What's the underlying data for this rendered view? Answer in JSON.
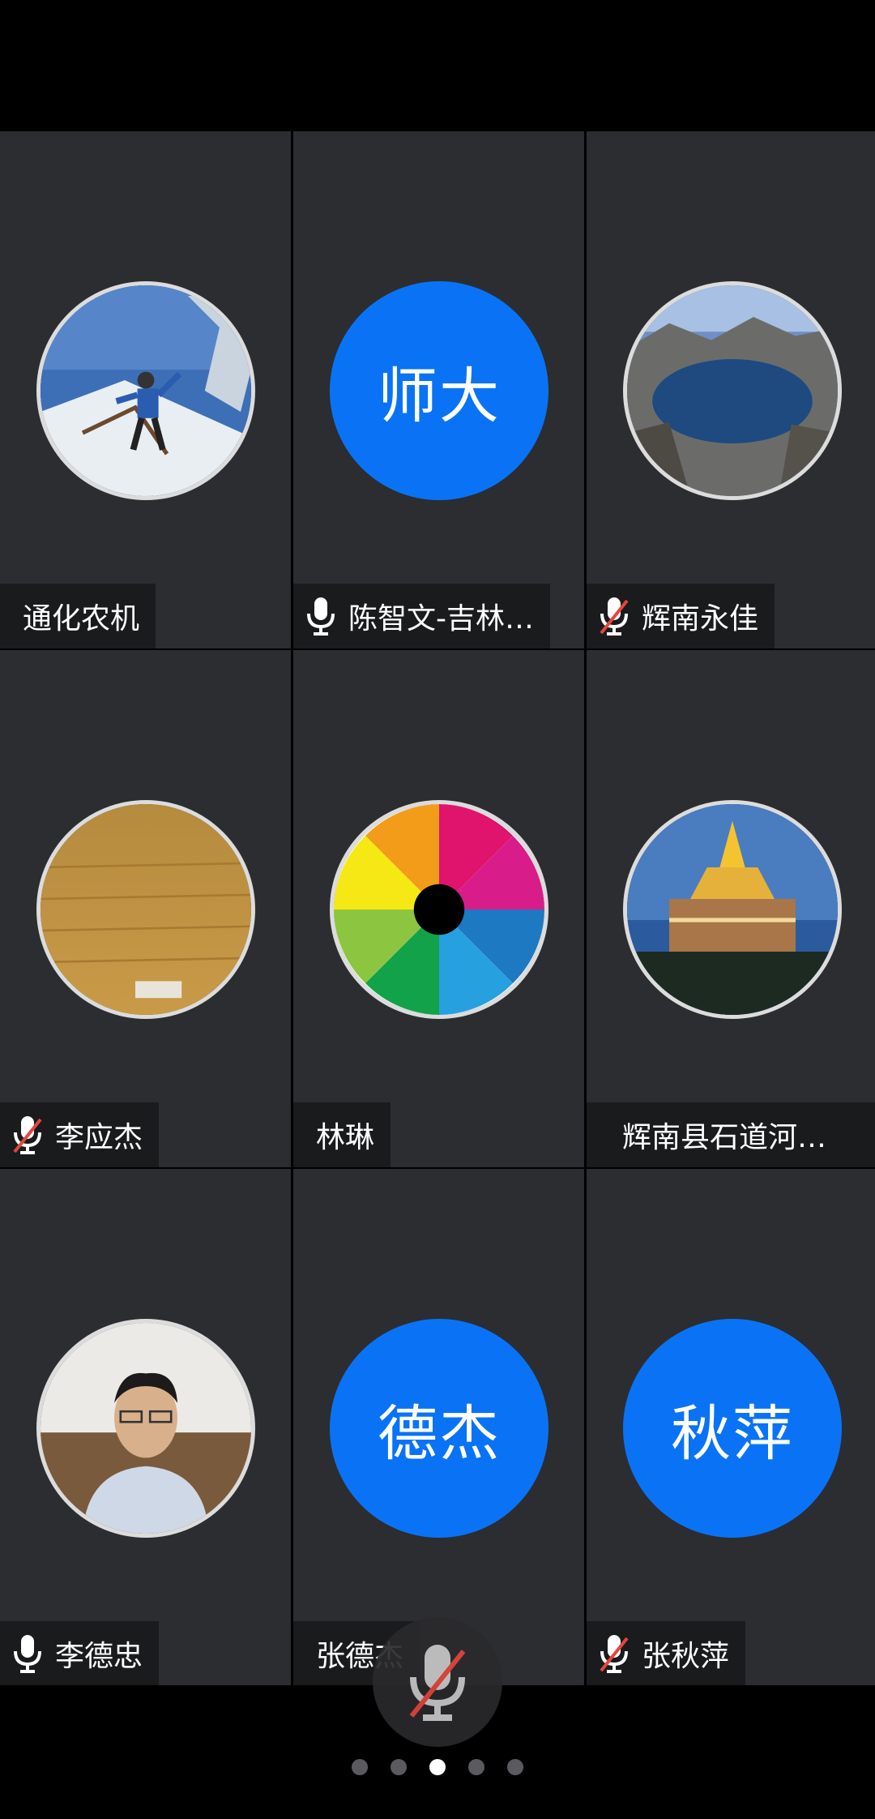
{
  "participants": [
    {
      "name": "通化农机",
      "mic": "none",
      "avatar": "photo-skier"
    },
    {
      "name": "陈智文-吉林…",
      "mic": "on",
      "avatar": "initials",
      "initials": "师大"
    },
    {
      "name": "辉南永佳",
      "mic": "muted",
      "avatar": "photo-lake"
    },
    {
      "name": "李应杰",
      "mic": "muted",
      "avatar": "photo-field"
    },
    {
      "name": "林琳",
      "mic": "none",
      "avatar": "photo-aperture"
    },
    {
      "name": "辉南县石道河…",
      "mic": "none",
      "avatar": "photo-building"
    },
    {
      "name": "李德忠",
      "mic": "on",
      "avatar": "photo-man"
    },
    {
      "name": "张德杰",
      "mic": "none",
      "avatar": "initials",
      "initials": "德杰"
    },
    {
      "name": "张秋萍",
      "mic": "muted",
      "avatar": "initials",
      "initials": "秋萍"
    }
  ],
  "controls": {
    "main_mic_state": "muted",
    "main_mic_icon": "mic-muted-icon"
  },
  "pagination": {
    "pages": 5,
    "current": 3
  },
  "colors": {
    "tile_bg": "#2b2d30",
    "avatar_blue": "#0a73f5",
    "label_bg": "#1a1b1d",
    "mute_red": "#e5453c"
  }
}
